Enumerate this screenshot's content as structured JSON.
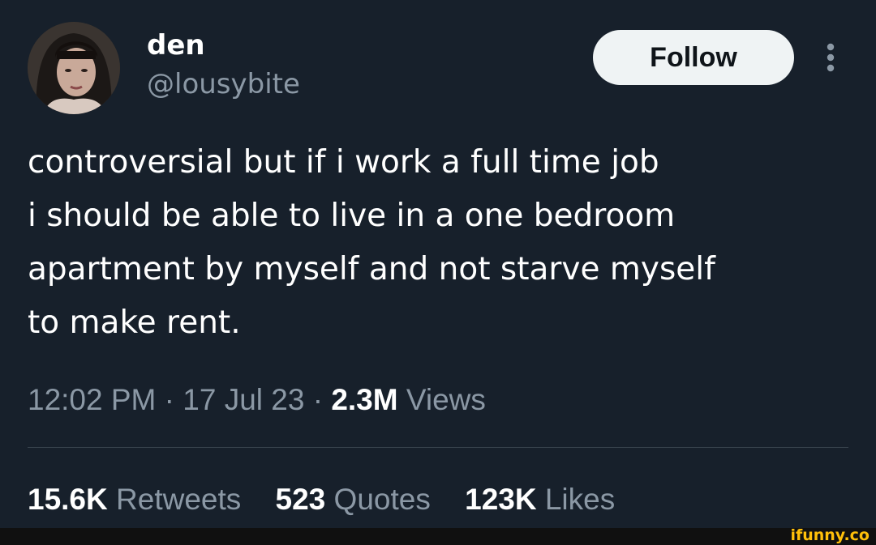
{
  "user": {
    "name": "den",
    "handle": "@lousybite"
  },
  "follow_label": "Follow",
  "tweet_text": "controversial but if i work a full time job\ni should be able to live in a one bedroom\napartment by myself and not starve myself\nto make rent.",
  "meta": {
    "time": "12:02 PM",
    "date": "17 Jul 23",
    "views_count": "2.3M",
    "views_label": "Views"
  },
  "stats": {
    "retweets_count": "15.6K",
    "retweets_label": "Retweets",
    "quotes_count": "523",
    "quotes_label": "Quotes",
    "likes_count": "123K",
    "likes_label": "Likes"
  },
  "watermark": "ifunny.co",
  "icons": {
    "more": "more-vertical-icon"
  },
  "colors": {
    "background": "#17202b",
    "secondary_text": "#8b98a5",
    "follow_button": "#eff3f4",
    "watermark": "#ffc00a"
  }
}
